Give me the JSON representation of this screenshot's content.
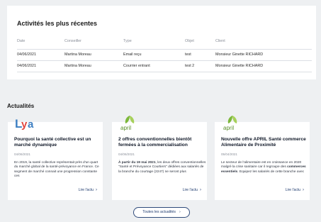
{
  "activities": {
    "title": "Activités les plus récentes",
    "columns": [
      "Date",
      "Conseiller",
      "Type",
      "Objet",
      "Client"
    ],
    "rows": [
      [
        "04/06/2021",
        "Martina Moreau",
        "Email reçu",
        "test",
        "Monsieur Ginette RICHARD"
      ],
      [
        "04/06/2021",
        "Martina Moreau",
        "Courrier entrant",
        "test 2",
        "Monsieur Ginette RICHARD"
      ]
    ]
  },
  "news": {
    "heading": "Actualités",
    "cards": [
      {
        "logo": "Lya",
        "title": "Pourquoi la santé collective est un marché dynamique",
        "date": "04/06/2021",
        "text": "En 2019, la santé collective représentait près d'un quart du marché global de la santé-prévoyance en France. Ce segment de marché connait une progression constante ces",
        "link": "Lire l'actu"
      },
      {
        "logo": "april",
        "title": "2 offres conventionnelles bientôt fermées à la commercialisation",
        "date": "04/06/2021",
        "text_bold": "À partir du 19 mai 2021",
        "text": ", les deux offres conventionnelles \"Santé et Prévoyance Courtiers\" dédiées aux salariés de la branche du courtage (2247) ne seront plus",
        "link": "Lire l'actu"
      },
      {
        "logo": "april",
        "title": "Nouvelle offre APRIL Santé commerce Alimentaire de Proximité",
        "date": "05/04/2021",
        "text_pre": "Le secteur de l'alimentaire est en croissance en 2020 malgré la crise sanitaire car il regroupe des ",
        "text_bold": "commerces essentiels",
        "text": ". Equipez les salariés de cette branche avec",
        "link": "Lire l'actu"
      }
    ],
    "all_button": "Toutes les actualités"
  },
  "colors": {
    "navy": "#1e3a6e",
    "april_green": "#7cb83a",
    "lya_blue": "#3d7fc2",
    "lya_red": "#e2463e"
  }
}
